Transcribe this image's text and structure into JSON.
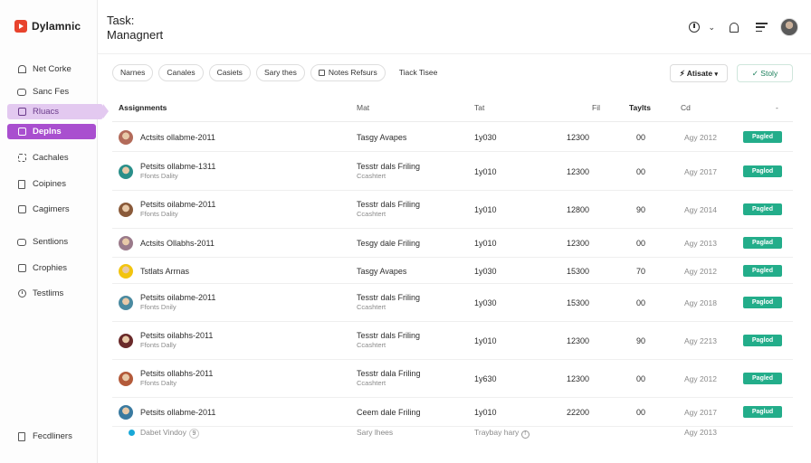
{
  "brand": {
    "name": "Dylamnic",
    "color": "#e8432d"
  },
  "header": {
    "title": "Task:\nManagnert"
  },
  "sidebar": {
    "items": [
      {
        "label": "Net Corke",
        "icon": "house-icon",
        "state": ""
      },
      {
        "label": "Sanc Fes",
        "icon": "chat-icon",
        "state": ""
      },
      {
        "label": "Rluacs",
        "icon": "box-icon",
        "state": "hover"
      },
      {
        "label": "Deplns",
        "icon": "box-icon",
        "state": "active"
      },
      {
        "label": "Cachales",
        "icon": "grid-icon",
        "state": ""
      },
      {
        "label": "Coipines",
        "icon": "doc-icon",
        "state": ""
      },
      {
        "label": "Cagimers",
        "icon": "box-icon",
        "state": ""
      },
      {
        "label": "Sentlions",
        "icon": "chat-icon",
        "state": ""
      },
      {
        "label": "Crophies",
        "icon": "box-icon",
        "state": ""
      },
      {
        "label": "Testlims",
        "icon": "clock-icon",
        "state": ""
      }
    ],
    "footer": {
      "label": "Fecdliners",
      "icon": "doc-icon"
    }
  },
  "filters": [
    {
      "label": "Narnes",
      "style": "chip"
    },
    {
      "label": "Canales",
      "style": "chip"
    },
    {
      "label": "Casiets",
      "style": "chip"
    },
    {
      "label": "Sary thes",
      "style": "chip"
    },
    {
      "label": "Notes Refsurs",
      "style": "chip-icon"
    },
    {
      "label": "Tiack Tisee",
      "style": "plain"
    }
  ],
  "actions": {
    "primary": "Atisate",
    "secondary": "Stoly"
  },
  "table": {
    "headers": {
      "assignments": "Assignments",
      "col2": "Mat",
      "col3": "Tat",
      "col4": "Fil",
      "col5": "Taylts",
      "col6": "Cd",
      "col7": "-"
    },
    "rows": [
      {
        "name": "Actsits ollabme-2011",
        "sub": "",
        "task": "Tasgy Avapes",
        "task_sub": "",
        "t": "1y030",
        "f": "12300",
        "ty": "00",
        "date": "Agy 2012",
        "status": "Pagled",
        "avatar": "#b36b5a"
      },
      {
        "name": "Petsits ollabme-1311",
        "sub": "Ffonts Dality",
        "task": "Tesstr dals Friling",
        "task_sub": "Ccashtert",
        "t": "1y010",
        "f": "12300",
        "ty": "00",
        "date": "Agy 2017",
        "status": "Paglod",
        "avatar": "#2a8f8a"
      },
      {
        "name": "Petsits oilabme-2011",
        "sub": "Ffonts Dality",
        "task": "Tesstr dals Friling",
        "task_sub": "Ccashtert",
        "t": "1y010",
        "f": "12800",
        "ty": "90",
        "date": "Agy 2014",
        "status": "Pagled",
        "avatar": "#8a5a3a"
      },
      {
        "name": "Actsits Ollabhs-2011",
        "sub": "",
        "task": "Tesgy dale Friling",
        "task_sub": "",
        "t": "1y010",
        "f": "12300",
        "ty": "00",
        "date": "Agy 2013",
        "status": "Paglad",
        "avatar": "#9a7a8a"
      },
      {
        "name": "Tstlats Arrnas",
        "sub": "",
        "task": "Tasgy Avapes",
        "task_sub": "",
        "t": "1y030",
        "f": "15300",
        "ty": "70",
        "date": "Agy 2012",
        "status": "Pagled",
        "avatar": "#f2c40f"
      },
      {
        "name": "Petsits oilabme-2011",
        "sub": "Ffonts Dnily",
        "task": "Tesstr dals Friling",
        "task_sub": "Ccashtert",
        "t": "1y030",
        "f": "15300",
        "ty": "00",
        "date": "Agy 2018",
        "status": "Paglod",
        "avatar": "#4a8aa0"
      },
      {
        "name": "Petsits oilabhs-2011",
        "sub": "Ffonts Dally",
        "task": "Tesstr dals Friling",
        "task_sub": "Ccashtert",
        "t": "1y010",
        "f": "12300",
        "ty": "90",
        "date": "Agy 2213",
        "status": "Paglod",
        "avatar": "#6a2a2a"
      },
      {
        "name": "Petsits ollabhs-2011",
        "sub": "Ffonts Dalty",
        "task": "Tesstr dala Friling",
        "task_sub": "Ccashtert",
        "t": "1y630",
        "f": "12300",
        "ty": "00",
        "date": "Agy 2012",
        "status": "Pagled",
        "avatar": "#b35a3a"
      },
      {
        "name": "Petsits ollabme-2011",
        "sub": "",
        "task": "Ceem dale Friling",
        "task_sub": "",
        "t": "1y010",
        "f": "22200",
        "ty": "00",
        "date": "Agy 2017",
        "status": "Paglud",
        "avatar": "#3a7aa0"
      }
    ],
    "footer_row": {
      "name": "Dabet Vindoy",
      "count": "9",
      "task": "Sary lhees",
      "t": "Traybay hary",
      "date": "Agy 2013"
    }
  },
  "colors": {
    "accent": "#a94fcf",
    "accent_light": "#e3c9f0",
    "status": "#23ad8a"
  }
}
